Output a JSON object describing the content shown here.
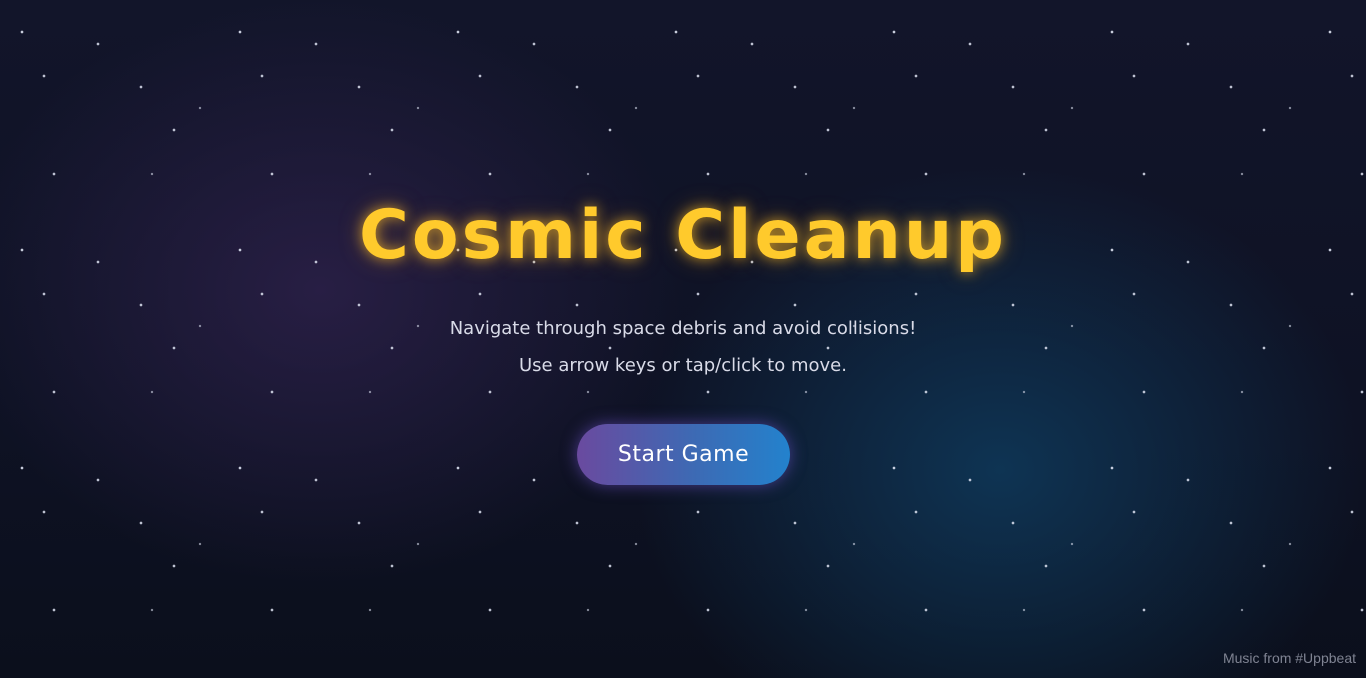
{
  "title": "Cosmic Cleanup",
  "instructions": {
    "line1": "Navigate through space debris and avoid collisions!",
    "line2": "Use arrow keys or tap/click to move."
  },
  "start_button_label": "Start Game",
  "credit": "Music from #Uppbeat",
  "colors": {
    "title": "#ffca2c",
    "button_gradient_start": "#6a4a9f",
    "button_gradient_end": "#2382cd",
    "background": "#0e1224"
  }
}
